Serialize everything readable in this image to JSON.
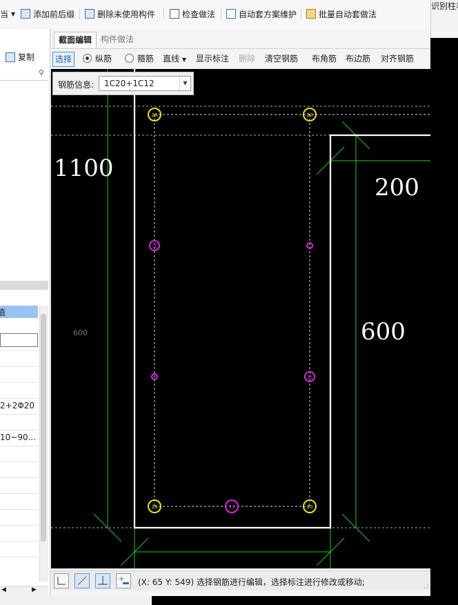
{
  "toolbar": {
    "left_fragment": "当",
    "items": [
      {
        "label": "添加前后缀",
        "icon": "add-prefix-icon"
      },
      {
        "label": "删除未使用构件",
        "icon": "delete-unused-icon"
      },
      {
        "label": "检查做法",
        "icon": "check-method-icon"
      },
      {
        "label": "自动套方案维护",
        "icon": "auto-scheme-icon"
      },
      {
        "label": "批量自动套做法",
        "icon": "batch-auto-icon"
      }
    ]
  },
  "right_panel": {
    "label_fragment": "识别柱表"
  },
  "left_panel": {
    "copy_label": "复制",
    "table_header": "值",
    "rows": [
      "",
      "",
      "",
      "",
      "",
      "2+2Φ20",
      "",
      "10~90...",
      "",
      "",
      "",
      "",
      "",
      "",
      ""
    ]
  },
  "editor": {
    "tabs": [
      "截面编辑",
      "构件做法"
    ],
    "tools": {
      "select": "选择",
      "longitudinal": "纵筋",
      "stirrup": "箍筋",
      "line": "直线",
      "show_dims": "显示标注",
      "delete": "删除",
      "clear": "清空钢筋",
      "corner": "布角筋",
      "edge": "布边筋",
      "align": "对齐钢筋"
    },
    "rebar_info": {
      "label": "钢筋信息:",
      "value": "1C20+1C12"
    },
    "dimensions": {
      "left_height": "1100",
      "right_width": "200",
      "right_height": "600",
      "small_dim": "600"
    },
    "rebar_labels": {
      "corner": "20",
      "edge": "12"
    }
  },
  "status": {
    "coords": "(X: 65 Y: 549)",
    "message": "选择钢筋进行编辑，选择标注进行修改或移动;"
  },
  "colors": {
    "canvas_bg": "#000000",
    "section_outline": "#ffffff",
    "dim_lines": "#22cc22",
    "corner_rebar": "#f2e600",
    "edge_rebar": "#e020e0",
    "select_accent": "#1a5fb4"
  }
}
